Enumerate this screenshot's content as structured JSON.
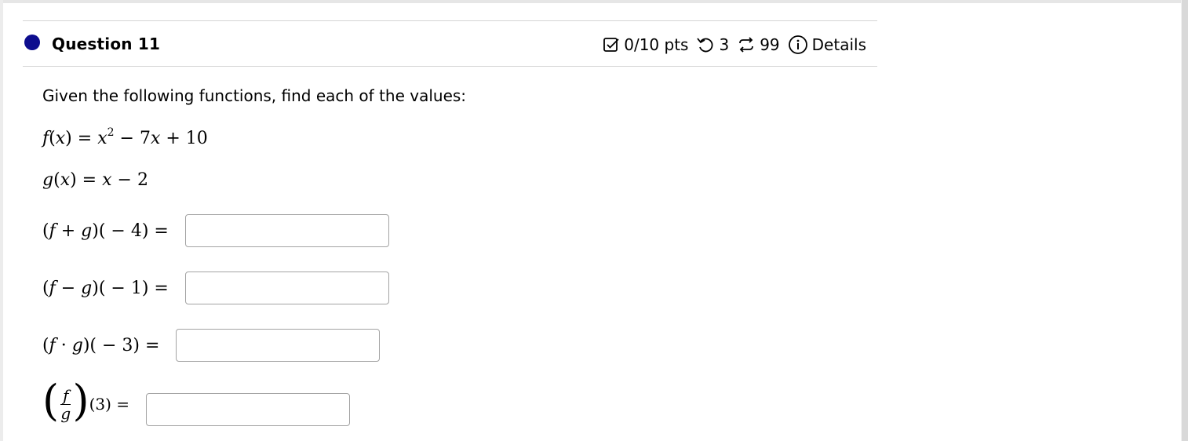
{
  "question": {
    "title": "Question 11",
    "points": "0/10 pts",
    "retries": "3",
    "attempts": "99",
    "details_label": "Details",
    "dot_color": "#0d0d8e"
  },
  "prompt": "Given the following functions, find each of the values:",
  "functions": {
    "f": "f(x) = x² − 7x + 10",
    "g": "g(x) = x − 2"
  },
  "parts": [
    {
      "expr": "(f + g)( − 4) =",
      "value": ""
    },
    {
      "expr": "(f − g)( − 1) =",
      "value": ""
    },
    {
      "expr": "(f · g)( − 3) =",
      "value": ""
    },
    {
      "expr": "(f/g)(3) =",
      "value": ""
    }
  ]
}
